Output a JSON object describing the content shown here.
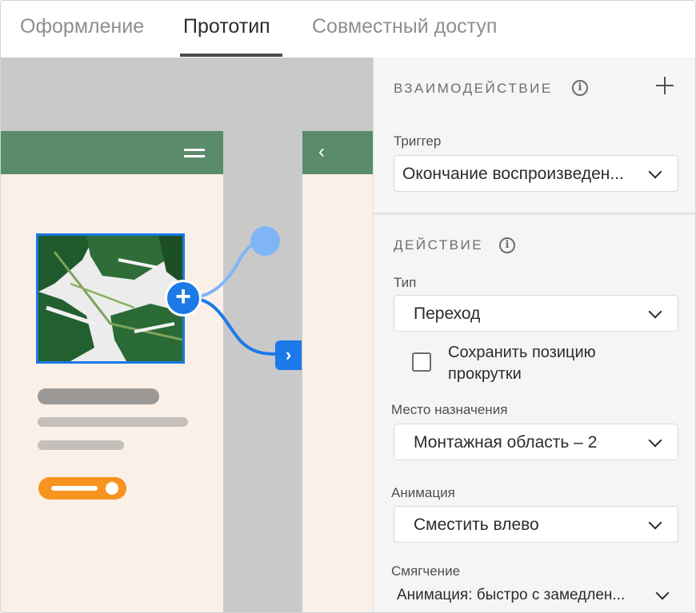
{
  "tabs": [
    {
      "label": "Оформление",
      "active": false
    },
    {
      "label": "Прототип",
      "active": true
    },
    {
      "label": "Совместный доступ",
      "active": false
    }
  ],
  "canvas": {
    "artboards": [
      {
        "header_icon": "hamburger-menu-icon"
      },
      {
        "header_icon": "back-chevron-icon",
        "chevron_glyph": "‹"
      }
    ],
    "link_handle_glyph": "+",
    "destination_glyph": "›",
    "colors": {
      "canvas_bg": "#c9c9c9",
      "artboard_bg": "#faf0e8",
      "header_green": "#5a8b6b",
      "accent_blue": "#1b79e8",
      "light_blue": "#7fb5f5",
      "button_orange": "#f7931e"
    }
  },
  "interaction": {
    "section_title": "ВЗАИМОДЕЙСТВИЕ",
    "trigger_label": "Триггер",
    "trigger_value": "Окончание воспроизведен..."
  },
  "action": {
    "section_title": "ДЕЙСТВИЕ",
    "type_label": "Тип",
    "type_value": "Переход",
    "preserve_scroll_label": "Сохранить позицию прокрутки",
    "preserve_scroll_checked": false,
    "destination_label": "Место назначения",
    "destination_value": "Монтажная область – 2",
    "animation_label": "Анимация",
    "animation_value": "Сместить влево",
    "easing_label": "Смягчение",
    "easing_value": "Анимация: быстро с замедлен..."
  }
}
